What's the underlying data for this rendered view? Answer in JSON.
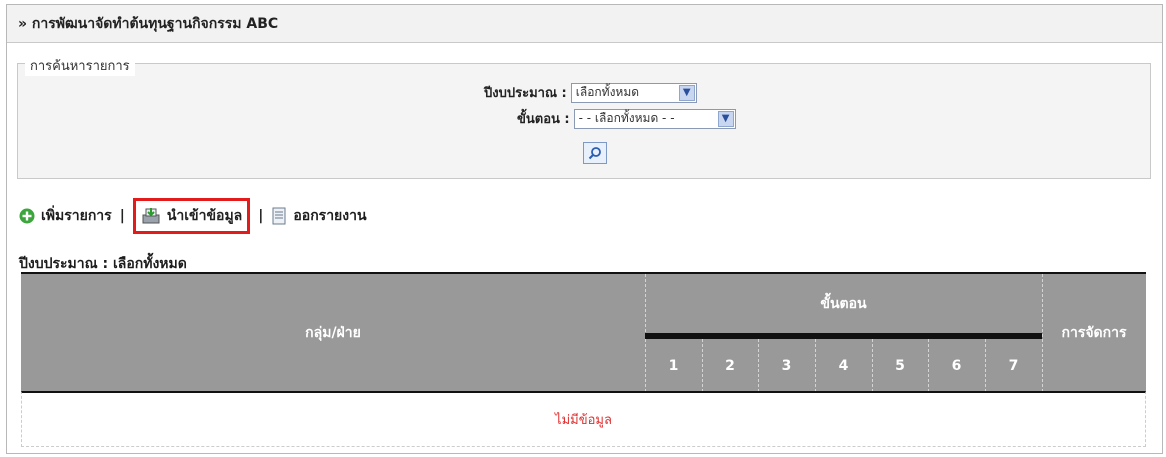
{
  "header": {
    "title": "» การพัฒนาจัดทำต้นทุนฐานกิจกรรม ABC"
  },
  "search": {
    "legend": "การค้นหารายการ",
    "year_label": "ปีงบประมาณ :",
    "year_value": "เลือกทั้งหมด",
    "step_label": "ขั้นตอน :",
    "step_value": "- - เลือกทั้งหมด - -",
    "search_icon": "magnifier-icon"
  },
  "toolbar": {
    "add_label": "เพิ่มรายการ",
    "import_label": "นำเข้าข้อมูล",
    "report_label": "ออกรายงาน",
    "separator": "|",
    "highlight_color": "#e31b1b"
  },
  "subtitle": "ปีงบประมาณ : เลือกทั้งหมด",
  "table": {
    "group_header": "กลุ่ม/ฝ่าย",
    "steps_header": "ขั้นตอน",
    "steps": [
      "1",
      "2",
      "3",
      "4",
      "5",
      "6",
      "7"
    ],
    "manage_header": "การจัดการ",
    "empty_text": "ไม่มีข้อมูล",
    "header_bg": "#999999"
  }
}
